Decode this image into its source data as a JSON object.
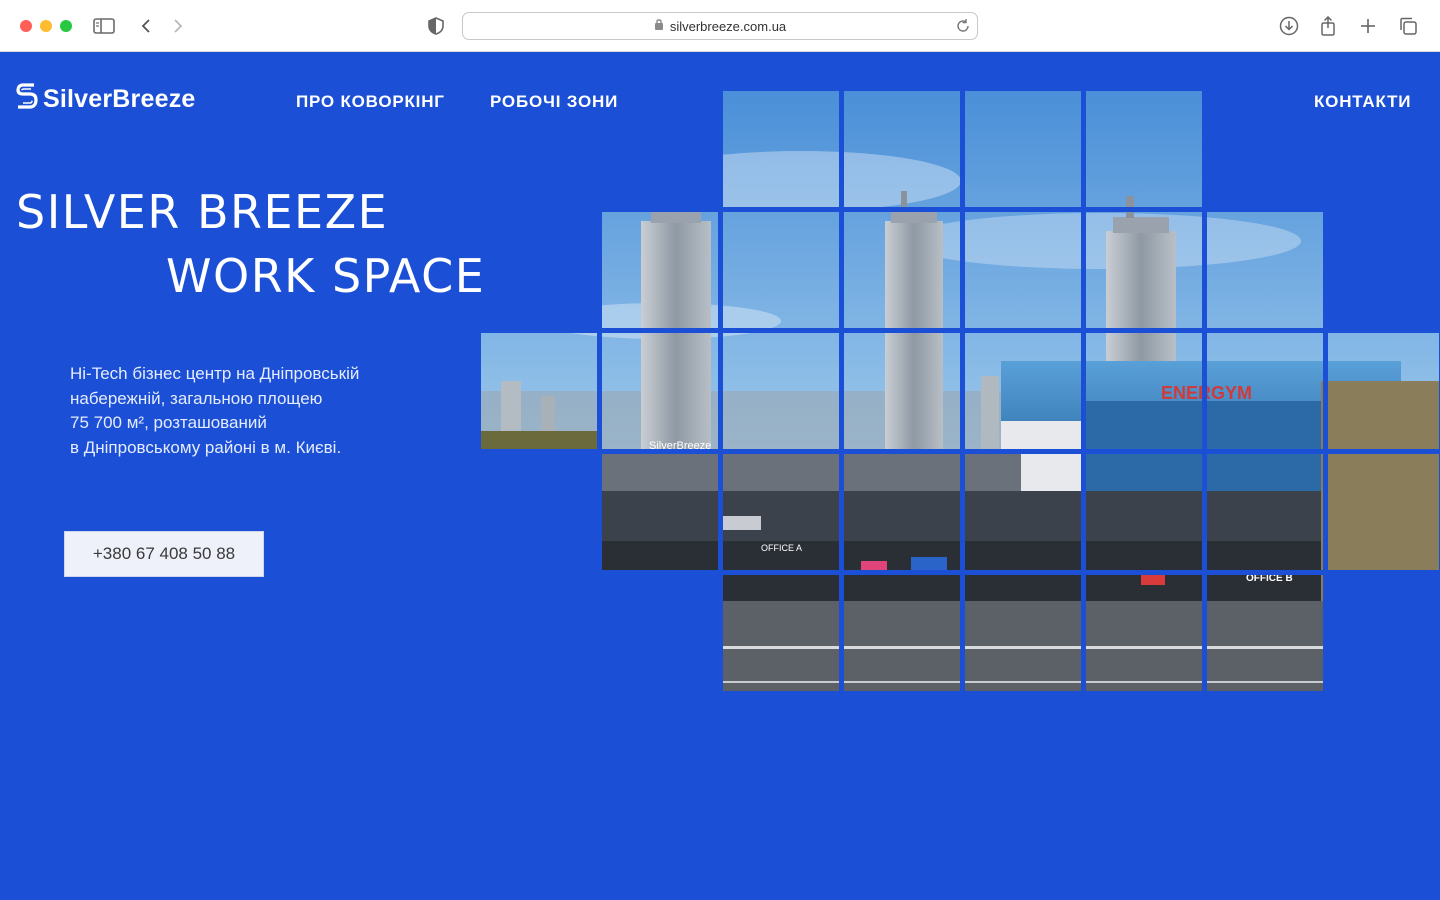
{
  "browser": {
    "url": "silverbreeze.com.ua",
    "icons": [
      "sidebar-icon",
      "back-icon",
      "forward-icon",
      "shield-icon",
      "lock-icon",
      "reload-icon",
      "download-icon",
      "share-icon",
      "new-tab-icon",
      "tabs-overview-icon"
    ]
  },
  "header": {
    "logo_text": "SilverBreeze",
    "nav": {
      "about": "ПРО КОВОРКІНГ",
      "zones": "РОБОЧІ ЗОНИ",
      "contacts": "КОНТАКТИ"
    }
  },
  "hero": {
    "title_line1": "SILVER BREEZE",
    "title_line2": "WORK SPACE",
    "description": [
      "Hi-Tech бізнес центр на Дніпровській",
      "набережній, загальною площею",
      "75 700 м², розташований",
      "в Дніпровському районі в м. Києві."
    ],
    "phone": "+380 67 408 50 88"
  },
  "photo": {
    "signs": {
      "building_sign": "SilverBreeze",
      "gym_sign": "ENERGYM",
      "office_a": "OFFICE A",
      "office_b": "OFFICE B"
    }
  },
  "colors": {
    "page_bg": "#1a4fd6",
    "white": "#ffffff",
    "button_bg": "#eef1fa"
  }
}
